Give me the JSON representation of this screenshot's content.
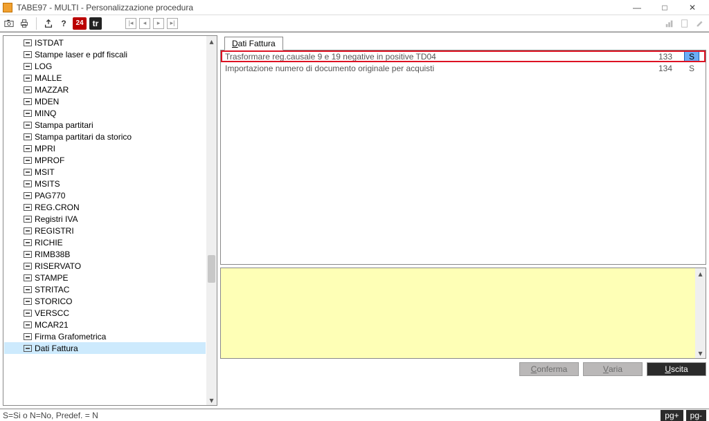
{
  "title": "TABE97  - MULTI -  Personalizzazione procedura",
  "toolbar": {
    "btn24": "24",
    "btnE": "tr"
  },
  "tree": {
    "items": [
      "ISTDAT",
      "Stampe laser e pdf fiscali",
      "LOG",
      "MALLE",
      "MAZZAR",
      "MDEN",
      "MINQ",
      "Stampa partitari",
      "Stampa partitari da storico",
      "MPRI",
      "MPROF",
      "MSIT",
      "MSITS",
      "PAG770",
      "REG.CRON",
      "Registri IVA",
      "REGISTRI",
      "RICHIE",
      "RIMB38B",
      "RISERVATO",
      "STAMPE",
      "STRITAC",
      "STORICO",
      "VERSCC",
      "MCAR21",
      "Firma Grafometrica",
      "Dati Fattura"
    ],
    "selected_index": 26
  },
  "tab": {
    "prefix": "D",
    "rest": "ati Fattura"
  },
  "rows": [
    {
      "desc": "Trasformare reg.causale 9 e 19 negative in positive TD04",
      "code": "133",
      "val": "S",
      "highlight": true
    },
    {
      "desc": "Importazione numero di documento originale per acquisti",
      "code": "134",
      "val": "S",
      "highlight": false
    }
  ],
  "buttons": {
    "conferma_pre": "C",
    "conferma_rest": "onferma",
    "varia_pre": "V",
    "varia_rest": "aria",
    "uscita_pre": "U",
    "uscita_rest": "scita"
  },
  "status": {
    "text": "S=Si o N=No, Predef. = N",
    "pgplus": "pg+",
    "pgminus": "pg-"
  }
}
